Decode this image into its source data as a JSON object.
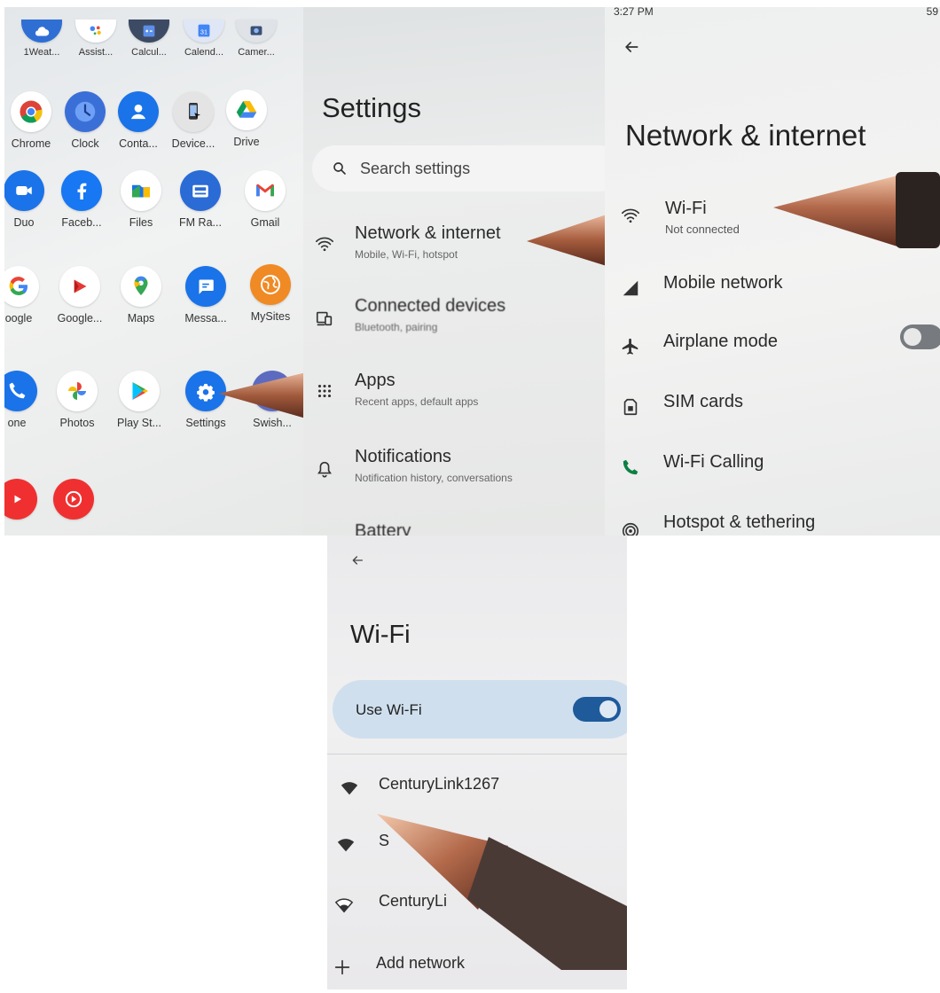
{
  "app_drawer": {
    "row1": [
      "1Weat...",
      "Assist...",
      "Calcul...",
      "Calend...",
      "Camer..."
    ],
    "row2": [
      "Chrome",
      "Clock",
      "Conta...",
      "Device...",
      "Drive"
    ],
    "row3": [
      "Duo",
      "Faceb...",
      "Files",
      "FM Ra...",
      "Gmail"
    ],
    "row4": [
      "oogle",
      "Google...",
      "Maps",
      "Messa...",
      "MySites"
    ],
    "row5": [
      "one",
      "Photos",
      "Play St...",
      "Settings",
      "Swish..."
    ],
    "calendar_day": "31"
  },
  "settings": {
    "title": "Settings",
    "search_placeholder": "Search settings",
    "items": [
      {
        "title": "Network & internet",
        "subtitle": "Mobile, Wi-Fi, hotspot"
      },
      {
        "title": "Connected devices",
        "subtitle": "Bluetooth, pairing"
      },
      {
        "title": "Apps",
        "subtitle": "Recent apps, default apps"
      },
      {
        "title": "Notifications",
        "subtitle": "Notification history, conversations"
      },
      {
        "title": "Battery"
      }
    ]
  },
  "network": {
    "status_time": "3:27 PM",
    "status_battery": "59",
    "title": "Network & internet",
    "items": [
      {
        "title": "Wi-Fi",
        "subtitle": "Not connected"
      },
      {
        "title": "Mobile network"
      },
      {
        "title": "Airplane mode",
        "toggle": "off"
      },
      {
        "title": "SIM cards"
      },
      {
        "title": "Wi-Fi Calling"
      },
      {
        "title": "Hotspot & tethering"
      }
    ]
  },
  "wifi": {
    "title": "Wi-Fi",
    "use_wifi_label": "Use Wi-Fi",
    "use_wifi_state": "on",
    "networks": [
      "CenturyLink1267",
      "S",
      "CenturyLi"
    ],
    "add_network_label": "Add network"
  },
  "colors": {
    "accent_blue": "#1f5a9b",
    "use_wifi_bg": "#cfdfee",
    "settings_icon": "#1a73e8",
    "call_green": "#0b8043"
  }
}
